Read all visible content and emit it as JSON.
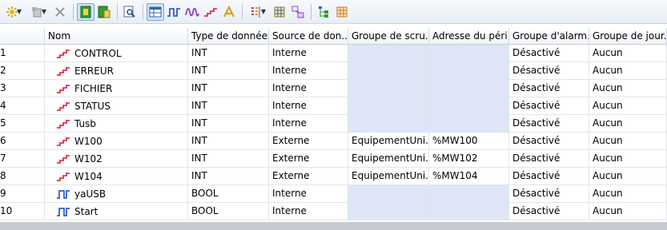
{
  "toolbar": {
    "buttons": [
      {
        "name": "new-variable-icon"
      },
      {
        "name": "delete-icon"
      },
      {
        "name": "close-icon"
      },
      {
        "name": "green-panel-icon"
      },
      {
        "name": "green-panel-alt-icon"
      },
      {
        "name": "search-icon"
      },
      {
        "name": "table-view-icon"
      },
      {
        "name": "digital-signal-icon"
      },
      {
        "name": "analog-signal-icon"
      },
      {
        "name": "ramp-signal-icon"
      },
      {
        "name": "text-icon"
      },
      {
        "name": "columns-icon"
      },
      {
        "name": "grid-icon"
      },
      {
        "name": "link-icon"
      },
      {
        "name": "tree-icon"
      },
      {
        "name": "table-icon"
      }
    ]
  },
  "table": {
    "columns": [
      "",
      "Nom",
      "Type de données",
      "Source de don...",
      "Groupe de scru...",
      "Adresse du péri...",
      "Groupe d'alarm...",
      "Groupe de jour..."
    ],
    "rows": [
      {
        "num": "1",
        "icon": "analog",
        "name": "CONTROL",
        "type": "INT",
        "source": "Interne",
        "scan": "",
        "addr": "",
        "alarm": "Désactivé",
        "log": "Aucun"
      },
      {
        "num": "2",
        "icon": "analog",
        "name": "ERREUR",
        "type": "INT",
        "source": "Interne",
        "scan": "",
        "addr": "",
        "alarm": "Désactivé",
        "log": "Aucun"
      },
      {
        "num": "3",
        "icon": "analog",
        "name": "FICHIER",
        "type": "INT",
        "source": "Interne",
        "scan": "",
        "addr": "",
        "alarm": "Désactivé",
        "log": "Aucun"
      },
      {
        "num": "4",
        "icon": "analog",
        "name": "STATUS",
        "type": "INT",
        "source": "Interne",
        "scan": "",
        "addr": "",
        "alarm": "Désactivé",
        "log": "Aucun"
      },
      {
        "num": "5",
        "icon": "analog",
        "name": "Tusb",
        "type": "INT",
        "source": "Interne",
        "scan": "",
        "addr": "",
        "alarm": "Désactivé",
        "log": "Aucun"
      },
      {
        "num": "6",
        "icon": "analog",
        "name": "W100",
        "type": "INT",
        "source": "Externe",
        "scan": "EquipementUni...",
        "addr": "%MW100",
        "alarm": "Désactivé",
        "log": "Aucun"
      },
      {
        "num": "7",
        "icon": "analog",
        "name": "W102",
        "type": "INT",
        "source": "Externe",
        "scan": "EquipementUni...",
        "addr": "%MW102",
        "alarm": "Désactivé",
        "log": "Aucun"
      },
      {
        "num": "8",
        "icon": "analog",
        "name": "W104",
        "type": "INT",
        "source": "Externe",
        "scan": "EquipementUni...",
        "addr": "%MW104",
        "alarm": "Désactivé",
        "log": "Aucun"
      },
      {
        "num": "9",
        "icon": "digital",
        "name": "yaUSB",
        "type": "BOOL",
        "source": "Interne",
        "scan": "",
        "addr": "",
        "alarm": "Désactivé",
        "log": "Aucun"
      },
      {
        "num": "10",
        "icon": "digital",
        "name": "Start",
        "type": "BOOL",
        "source": "Interne",
        "scan": "",
        "addr": "",
        "alarm": "Désactivé",
        "log": "Aucun"
      }
    ]
  }
}
